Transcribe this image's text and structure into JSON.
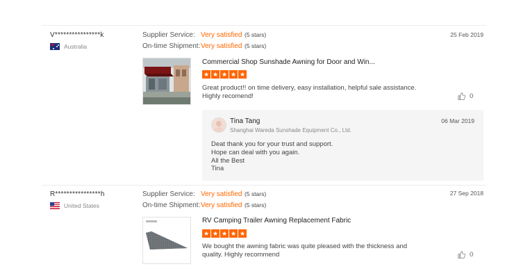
{
  "supplier_service_label": "Supplier Service:",
  "shipment_label": "On-time Shipment:",
  "reviews": [
    {
      "user": "V****************k",
      "country": "Australia",
      "supplier_service": "Very satisfied",
      "supplier_service_stars": "(5 stars)",
      "shipment": "Very satisfied",
      "shipment_stars": "(5 stars)",
      "date": "25 Feb 2019",
      "product_title": "Commercial Shop Sunshade Awning for Door and Win...",
      "rating": 5,
      "text": "Great product!! on time delivery, easy installation, helpful sale assistance. Highly recomend!",
      "likes": "0",
      "reply": {
        "name": "Tina Tang",
        "company": "Shanghai Wareda Sunshade Equipment Co., Ltd.",
        "date": "06 Mar 2019",
        "lines": [
          "Deat thank you for your trust and support.",
          "Hope can deal with you again.",
          "All the Best",
          "Tina"
        ]
      }
    },
    {
      "user": "R****************h",
      "country": "United States",
      "supplier_service": "Very satisfied",
      "supplier_service_stars": "(5 stars)",
      "shipment": "Very satisfied",
      "shipment_stars": "(5 stars)",
      "date": "27 Sep 2018",
      "product_title": "RV Camping Trailer Awning Replacement Fabric",
      "rating": 5,
      "text": "We bought the awning fabric was quite pleased with the thickness and quality. Highly recommend",
      "likes": "0"
    }
  ],
  "colors": {
    "accent": "#ff6600",
    "reply_bg": "#f5f5f5"
  },
  "icons": {
    "like": "thumbs-up-icon",
    "star": "star-icon"
  }
}
